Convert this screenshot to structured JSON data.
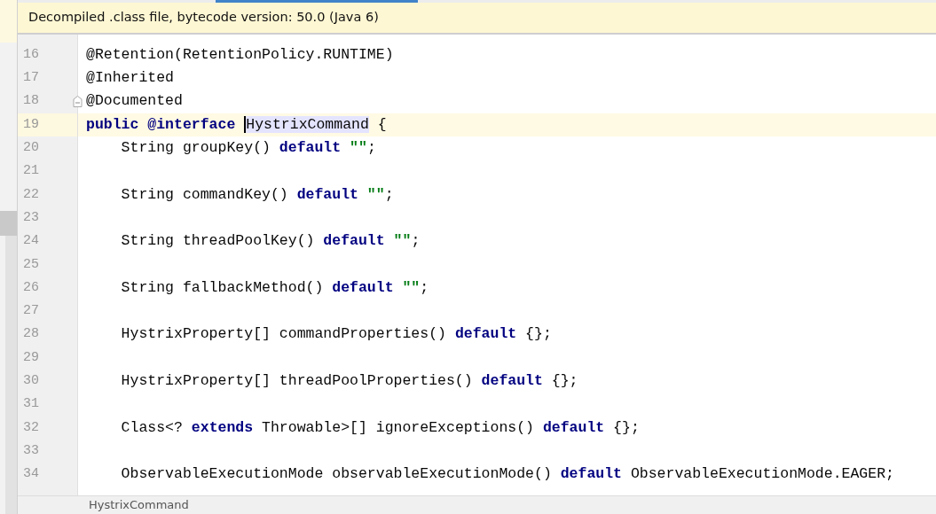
{
  "editor_tabs": {
    "selected_tab": {
      "selected": true
    }
  },
  "banner": {
    "text": "Decompiled .class file, bytecode version: 50.0 (Java 6)"
  },
  "lines": [
    {
      "number": "16",
      "current": false,
      "fold": false,
      "tokens": [
        {
          "kind": "plain",
          "text": "@Retention(RetentionPolicy.RUNTIME)"
        }
      ]
    },
    {
      "number": "17",
      "current": false,
      "fold": false,
      "tokens": [
        {
          "kind": "plain",
          "text": "@Inherited"
        }
      ]
    },
    {
      "number": "18",
      "current": false,
      "fold": true,
      "tokens": [
        {
          "kind": "plain",
          "text": "@Documented"
        }
      ]
    },
    {
      "number": "19",
      "current": true,
      "fold": false,
      "tokens": [
        {
          "kind": "keyword",
          "text": "public @interface "
        },
        {
          "kind": "highlight",
          "text": "HystrixCommand"
        },
        {
          "kind": "plain",
          "text": " {"
        }
      ]
    },
    {
      "number": "20",
      "current": false,
      "fold": false,
      "tokens": [
        {
          "kind": "plain",
          "text": "    String groupKey() "
        },
        {
          "kind": "keyword",
          "text": "default"
        },
        {
          "kind": "string",
          "text": " \"\""
        },
        {
          "kind": "plain",
          "text": ";"
        }
      ]
    },
    {
      "number": "21",
      "current": false,
      "fold": false
    },
    {
      "number": "22",
      "current": false,
      "fold": false,
      "tokens": [
        {
          "kind": "plain",
          "text": "    String commandKey() "
        },
        {
          "kind": "keyword",
          "text": "default"
        },
        {
          "kind": "string",
          "text": " \"\""
        },
        {
          "kind": "plain",
          "text": ";"
        }
      ]
    },
    {
      "number": "23",
      "current": false,
      "fold": false
    },
    {
      "number": "24",
      "current": false,
      "fold": false,
      "tokens": [
        {
          "kind": "plain",
          "text": "    String threadPoolKey() "
        },
        {
          "kind": "keyword",
          "text": "default"
        },
        {
          "kind": "string",
          "text": " \"\""
        },
        {
          "kind": "plain",
          "text": ";"
        }
      ]
    },
    {
      "number": "25",
      "current": false,
      "fold": false
    },
    {
      "number": "26",
      "current": false,
      "fold": false,
      "tokens": [
        {
          "kind": "plain",
          "text": "    String fallbackMethod() "
        },
        {
          "kind": "keyword",
          "text": "default"
        },
        {
          "kind": "string",
          "text": " \"\""
        },
        {
          "kind": "plain",
          "text": ";"
        }
      ]
    },
    {
      "number": "27",
      "current": false,
      "fold": false
    },
    {
      "number": "28",
      "current": false,
      "fold": false,
      "tokens": [
        {
          "kind": "plain",
          "text": "    HystrixProperty[] commandProperties() "
        },
        {
          "kind": "keyword",
          "text": "default"
        },
        {
          "kind": "plain",
          "text": " {};"
        }
      ]
    },
    {
      "number": "29",
      "current": false,
      "fold": false
    },
    {
      "number": "30",
      "current": false,
      "fold": false,
      "tokens": [
        {
          "kind": "plain",
          "text": "    HystrixProperty[] threadPoolProperties() "
        },
        {
          "kind": "keyword",
          "text": "default"
        },
        {
          "kind": "plain",
          "text": " {};"
        }
      ]
    },
    {
      "number": "31",
      "current": false,
      "fold": false
    },
    {
      "number": "32",
      "current": false,
      "fold": false,
      "tokens": [
        {
          "kind": "plain",
          "text": "    Class<? "
        },
        {
          "kind": "keyword",
          "text": "extends"
        },
        {
          "kind": "plain",
          "text": " Throwable>[] ignoreExceptions() "
        },
        {
          "kind": "keyword",
          "text": "default"
        },
        {
          "kind": "plain",
          "text": " {};"
        }
      ]
    },
    {
      "number": "33",
      "current": false,
      "fold": false
    },
    {
      "number": "34",
      "current": false,
      "fold": false,
      "tokens": [
        {
          "kind": "plain",
          "text": "    ObservableExecutionMode observableExecutionMode() "
        },
        {
          "kind": "keyword",
          "text": "default"
        },
        {
          "kind": "plain",
          "text": " ObservableExecutionMode.EAGER;"
        }
      ]
    }
  ],
  "breadcrumb": {
    "text": "HystrixCommand"
  }
}
